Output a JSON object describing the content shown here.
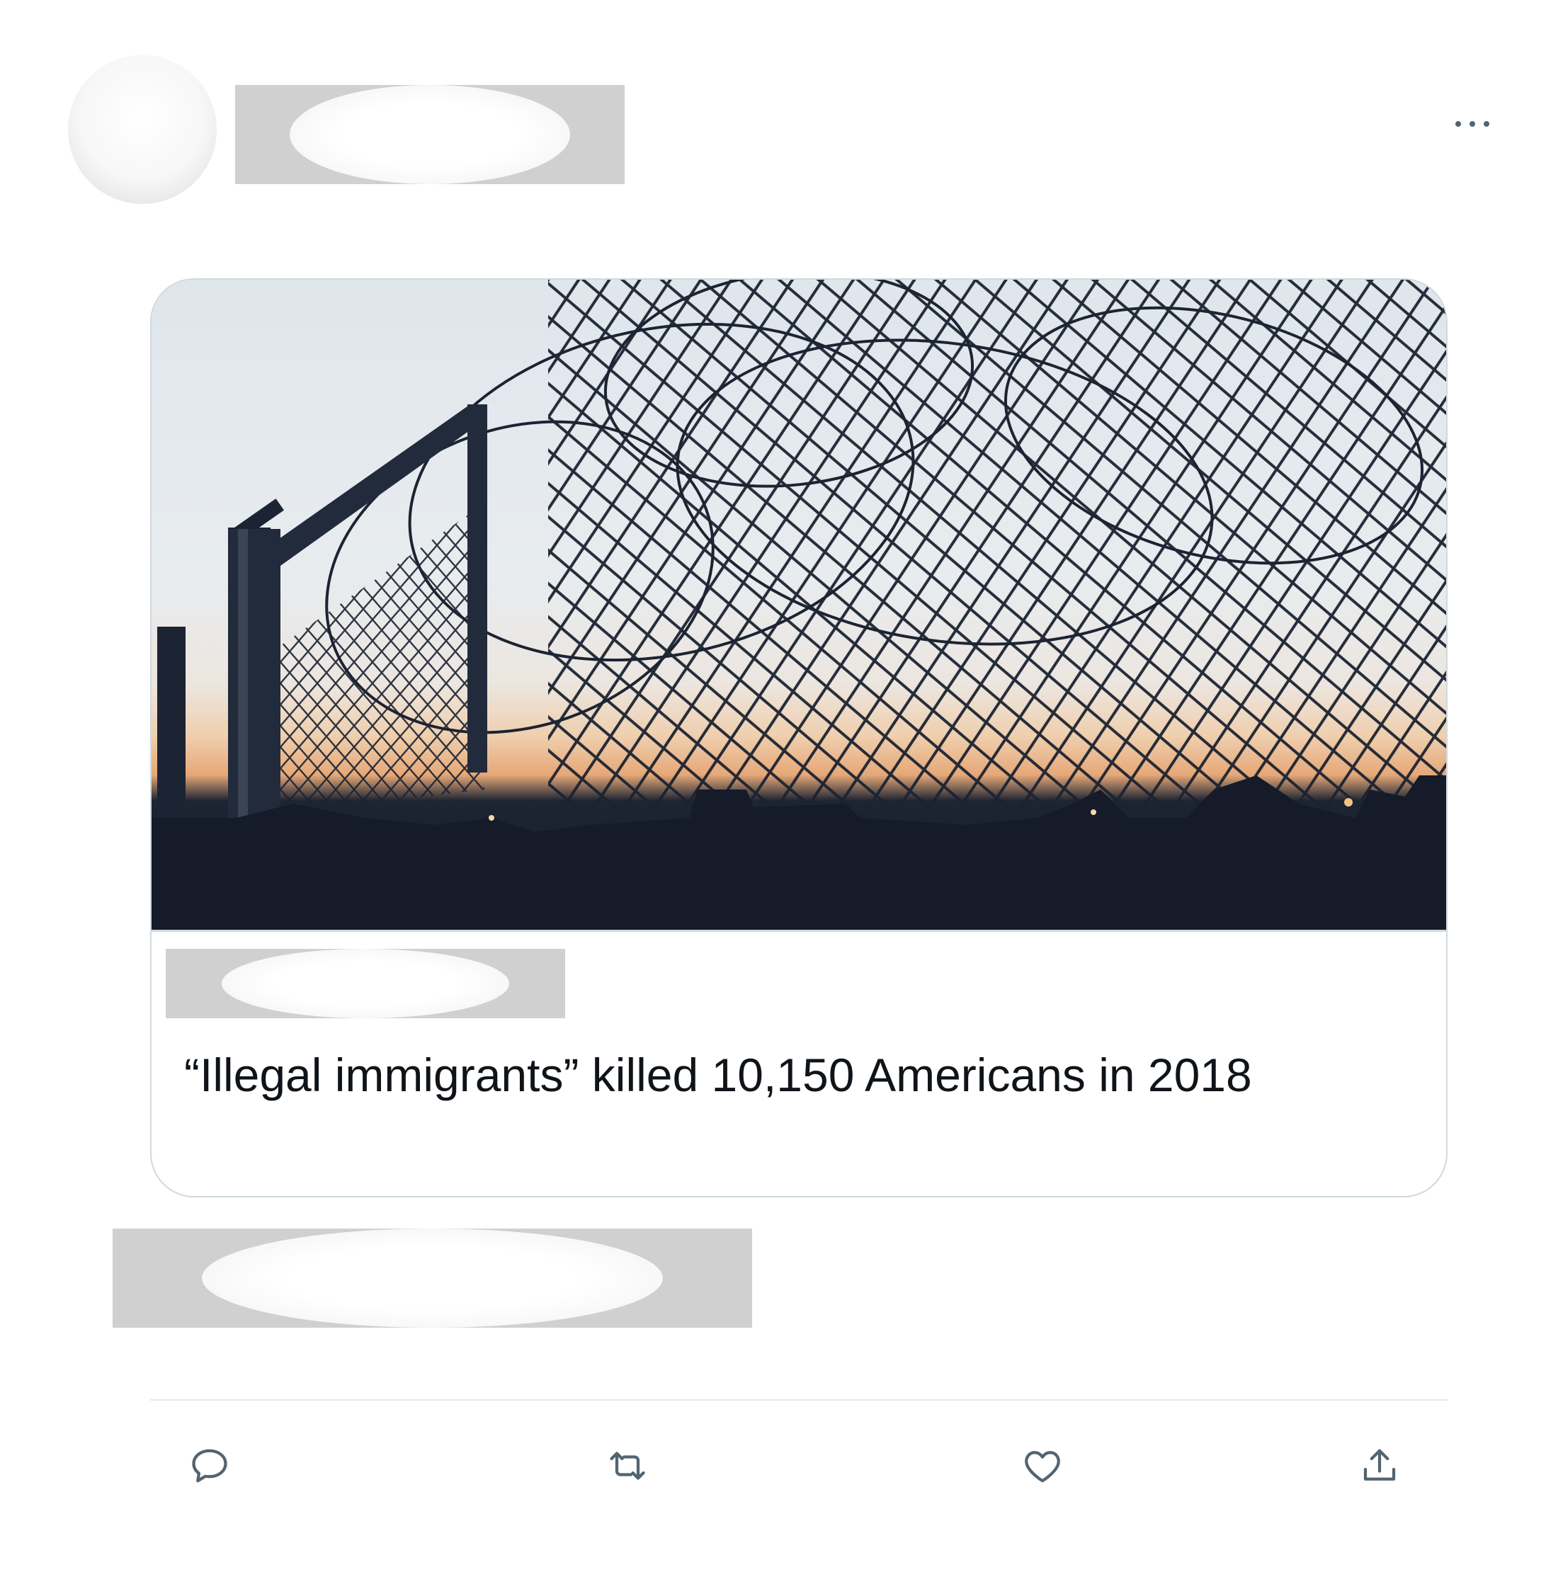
{
  "tweet": {
    "author": {
      "avatar_icon": "avatar-redacted",
      "name_icon": "redacted-block"
    },
    "more_icon": "more-dots-icon",
    "card": {
      "image_icon": "barbed-wire-fence-photo",
      "domain_icon": "redacted-block",
      "title": "“Illegal immigrants” killed 10,150 Americans in 2018"
    },
    "source_icon": "redacted-block",
    "actions": [
      {
        "icon": "reply-icon"
      },
      {
        "icon": "retweet-icon"
      },
      {
        "icon": "like-icon"
      },
      {
        "icon": "share-icon"
      }
    ],
    "colors": {
      "icon": "#536471",
      "border": "#cfd9de",
      "text": "#0f1419",
      "redacted": "#d0d0d0"
    }
  }
}
